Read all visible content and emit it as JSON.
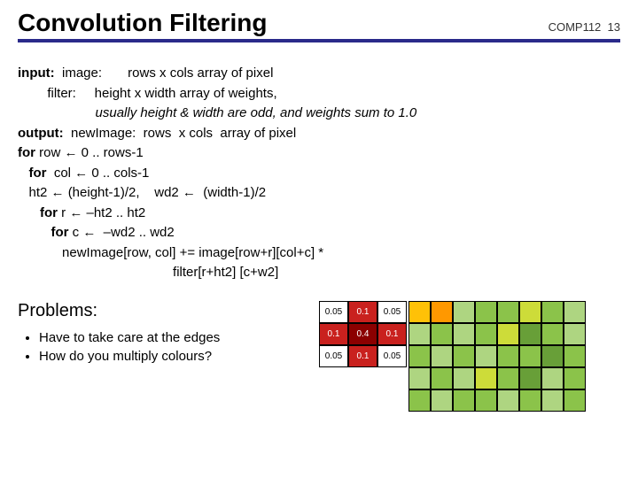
{
  "header": {
    "title": "Convolution Filtering",
    "course": "COMP112",
    "page": "13"
  },
  "algo": {
    "l1a": "input:",
    "l1b": "  image:       rows x cols array of pixel",
    "l2a": "        filter:     height x width array of weights,",
    "l2b": "                     usually height & width are odd, and weights sum to 1.0",
    "l3a": "output:",
    "l3b": "  newImage:  rows  x cols  array of pixel",
    "l4a": "for",
    "l4b": " row ← 0 .. rows-1",
    "l5a": "   for",
    "l5b": "  col ← 0 .. cols-1",
    "l6": "   ht2 ← (height-1)/2,    wd2 ←  (width-1)/2",
    "l7a": "      for",
    "l7b": " r ← –ht2 .. ht2",
    "l8a": "         for",
    "l8b": " c ←  –wd2 .. wd2",
    "l9": "            newImage[row, col] += image[row+r][col+c] *",
    "l10": "                                          filter[r+ht2] [c+w2]"
  },
  "problems": {
    "title": "Problems:",
    "b1": "Have to take care at the edges",
    "b2": "How do you multiply colours?"
  },
  "kernel": {
    "r0": [
      "0.05",
      "0.1",
      "0.05"
    ],
    "r1": [
      "0.1",
      "0.4",
      "0.1"
    ],
    "r2": [
      "0.05",
      "0.1",
      "0.05"
    ]
  }
}
